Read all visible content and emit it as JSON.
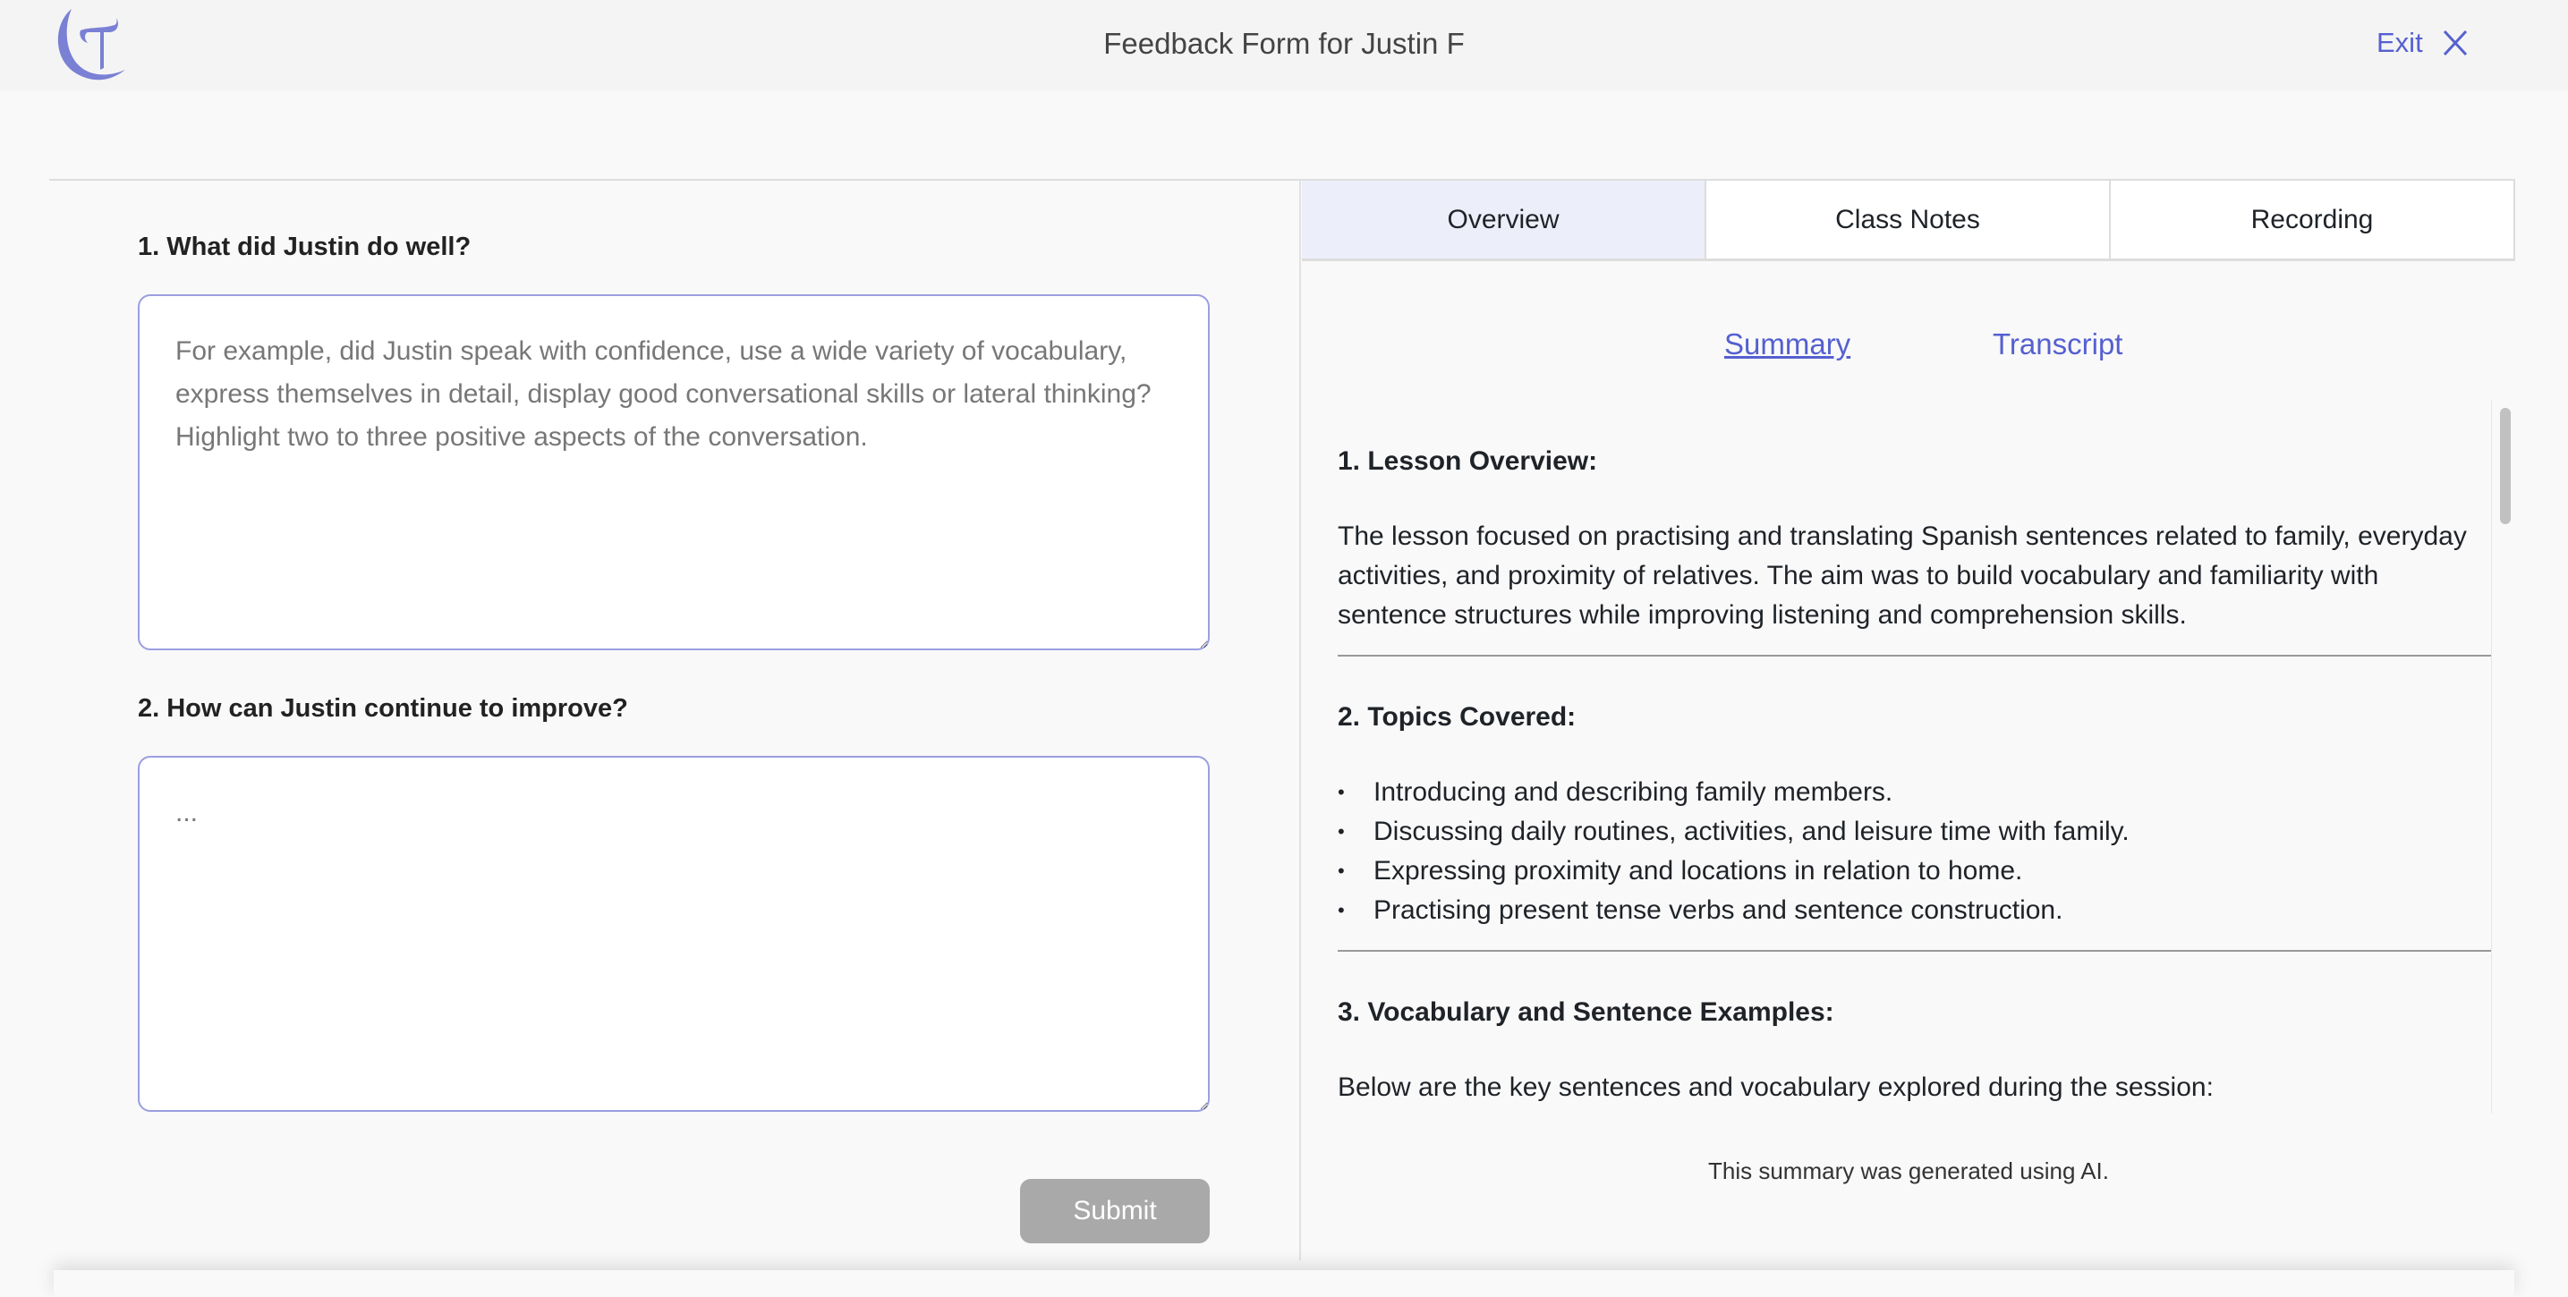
{
  "header": {
    "title": "Feedback Form for Justin F",
    "exit_label": "Exit",
    "logo_text": "T"
  },
  "form": {
    "q1": {
      "label": "1. What did Justin do well?",
      "placeholder": "For example, did Justin speak with confidence, use a wide variety of vocabulary, express themselves in detail, display good conversational skills or lateral thinking? Highlight two to three positive aspects of the conversation."
    },
    "q2": {
      "label": "2. How can Justin continue to improve?",
      "placeholder": "..."
    },
    "submit_label": "Submit"
  },
  "tabs": [
    {
      "label": "Overview"
    },
    {
      "label": "Class Notes"
    },
    {
      "label": "Recording"
    }
  ],
  "subtabs": {
    "summary": "Summary",
    "transcript": "Transcript"
  },
  "summary": {
    "s1": {
      "heading": "1. Lesson Overview:",
      "text": "The lesson focused on practising and translating Spanish sentences related to family, everyday activities, and proximity of relatives. The aim was to build vocabulary and familiarity with sentence structures while improving listening and comprehension skills."
    },
    "s2": {
      "heading": "2. Topics Covered:",
      "items": [
        "Introducing and describing family members.",
        "Discussing daily routines, activities, and leisure time with family.",
        "Expressing proximity and locations in relation to home.",
        "Practising present tense verbs and sentence construction."
      ]
    },
    "s3": {
      "heading": "3. Vocabulary and Sentence Examples:",
      "text": "Below are the key sentences and vocabulary explored during the session:"
    }
  },
  "ai_note": "This summary was generated using AI."
}
